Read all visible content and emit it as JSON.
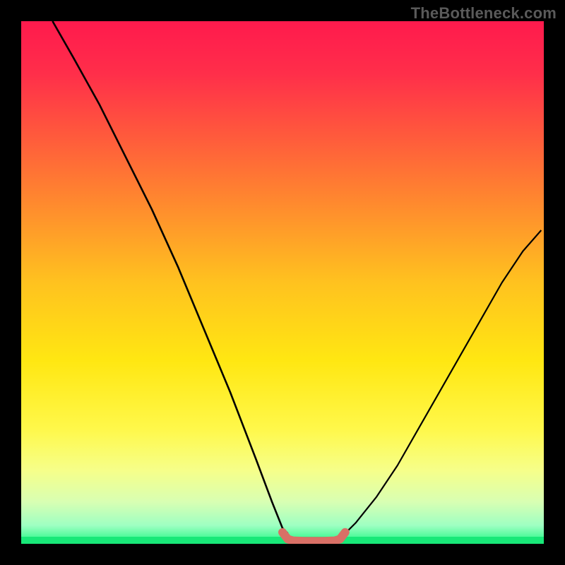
{
  "watermark_text": "TheBottleneck.com",
  "chart_data": {
    "type": "line",
    "title": "",
    "xlabel": "",
    "ylabel": "",
    "xlim": [
      0,
      100
    ],
    "ylim": [
      0,
      100
    ],
    "grid": false,
    "legend": false,
    "annotations": [],
    "gradient_stops": [
      {
        "offset": 0.0,
        "color": "#ff1a4d"
      },
      {
        "offset": 0.1,
        "color": "#ff2e4a"
      },
      {
        "offset": 0.22,
        "color": "#ff5a3c"
      },
      {
        "offset": 0.35,
        "color": "#ff8a2e"
      },
      {
        "offset": 0.5,
        "color": "#ffc21f"
      },
      {
        "offset": 0.65,
        "color": "#ffe712"
      },
      {
        "offset": 0.78,
        "color": "#fff84a"
      },
      {
        "offset": 0.86,
        "color": "#f6ff8a"
      },
      {
        "offset": 0.92,
        "color": "#d8ffb3"
      },
      {
        "offset": 0.965,
        "color": "#9effc2"
      },
      {
        "offset": 1.0,
        "color": "#1cf781"
      }
    ],
    "series": [
      {
        "name": "left-curve",
        "stroke": "#000000",
        "stroke_width": 2.6,
        "x": [
          6,
          10,
          15,
          20,
          25,
          30,
          35,
          40,
          45,
          48,
          50,
          51
        ],
        "y": [
          100,
          93,
          84,
          74,
          64,
          53,
          41,
          29,
          16,
          8,
          3,
          2
        ]
      },
      {
        "name": "right-curve",
        "stroke": "#000000",
        "stroke_width": 2.2,
        "x": [
          62,
          64,
          68,
          72,
          76,
          80,
          84,
          88,
          92,
          96,
          99.5
        ],
        "y": [
          2,
          4,
          9,
          15,
          22,
          29,
          36,
          43,
          50,
          56,
          60
        ]
      },
      {
        "name": "floor-segment",
        "stroke": "#d97066",
        "stroke_width": 12,
        "linecap": "round",
        "x": [
          50,
          51,
          52,
          54,
          56,
          58,
          60,
          61,
          62
        ],
        "y": [
          2.2,
          0.9,
          0.6,
          0.5,
          0.5,
          0.5,
          0.6,
          0.9,
          2.2
        ]
      }
    ]
  }
}
